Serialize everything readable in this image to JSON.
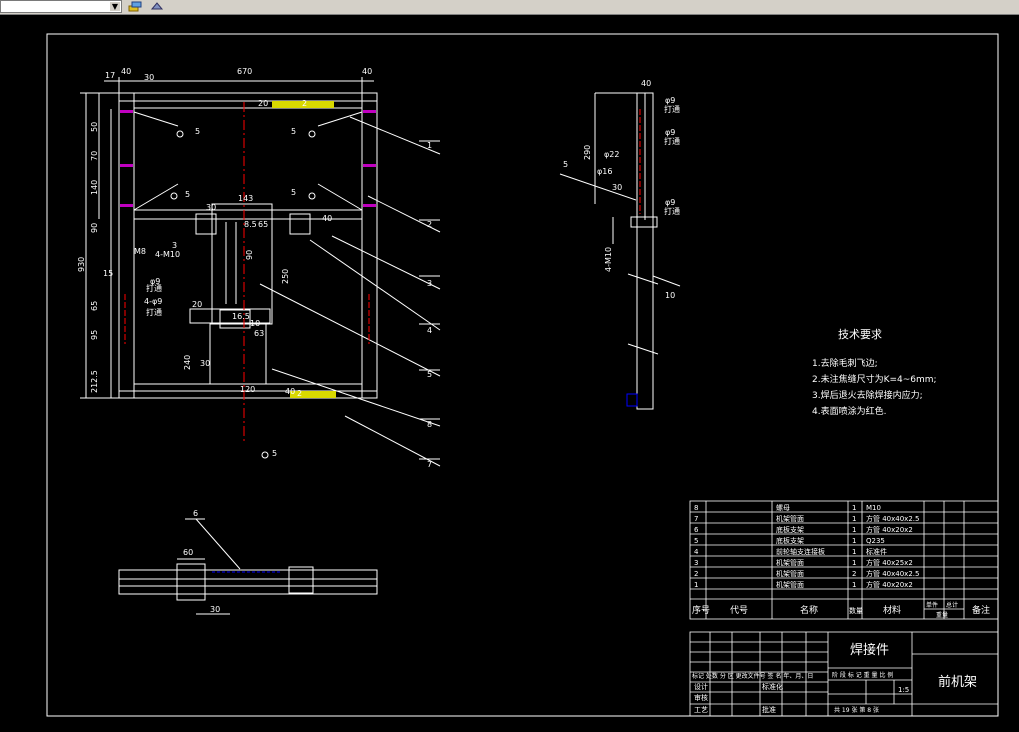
{
  "toolbar": {
    "layer_combo_value": "",
    "icons": [
      "layer-states-icon",
      "layer-previous-icon"
    ]
  },
  "main_view": {
    "dims_top": [
      "17",
      "40",
      "30",
      "670",
      "40",
      "20",
      "2"
    ],
    "dims_left": [
      "50",
      "70",
      "140",
      "90",
      "930",
      "15",
      "65",
      "95",
      "212.5"
    ],
    "dims_inner": [
      "143",
      "30",
      "8.5",
      "65",
      "40",
      "3",
      "M8",
      "4-M10",
      "90",
      "250",
      "16.5",
      "10",
      "63",
      "20",
      "240",
      "30",
      "120",
      "40",
      "2"
    ],
    "hole_notes": [
      "φ9",
      "打通",
      "4-φ9",
      "打通"
    ],
    "weld_marks": [
      "5",
      "5",
      "5",
      "5",
      "5"
    ],
    "callouts": [
      "1",
      "2",
      "3",
      "4",
      "5",
      "8",
      "7"
    ]
  },
  "side_view": {
    "dims": [
      "40",
      "290",
      "φ22",
      "φ16",
      "30",
      "4-M10",
      "10"
    ],
    "hole_notes": [
      "φ9",
      "打通",
      "φ9",
      "打通",
      "φ9",
      "打通"
    ],
    "weld_marks": [
      "5"
    ]
  },
  "bottom_view": {
    "dims": [
      "60",
      "30"
    ],
    "callout": "6"
  },
  "tech_requirements": {
    "title": "技术要求",
    "items": [
      "1.去除毛刺飞边;",
      "2.未注焦缝尺寸为K=4~6mm;",
      "3.焊后退火去除焊接内应力;",
      "4.表面喷涂为红色."
    ]
  },
  "bom": {
    "rows": [
      {
        "no": "8",
        "name": "螺母",
        "qty": "1",
        "material": "M10"
      },
      {
        "no": "7",
        "name": "机架管面",
        "qty": "1",
        "material": "方管 40x40x2.5"
      },
      {
        "no": "6",
        "name": "底板支架",
        "qty": "1",
        "material": "方管 40x20x2"
      },
      {
        "no": "5",
        "name": "底板支架",
        "qty": "1",
        "material": "Q235"
      },
      {
        "no": "4",
        "name": "前轮轴支连接板",
        "qty": "1",
        "material": "标准件"
      },
      {
        "no": "3",
        "name": "机架管面",
        "qty": "1",
        "material": "方管 40x25x2"
      },
      {
        "no": "2",
        "name": "机架管面",
        "qty": "2",
        "material": "方管 40x40x2.5"
      },
      {
        "no": "1",
        "name": "机架管面",
        "qty": "1",
        "material": "方管 40x20x2"
      }
    ],
    "headers": {
      "no": "序号",
      "code": "代号",
      "name": "名称",
      "qty": "数量",
      "material": "材料",
      "unit_weight": "单件",
      "total_weight": "总计",
      "weight": "重量",
      "remarks": "备注"
    }
  },
  "title_block": {
    "part_name": "焊接件",
    "drawing_title": "前机架",
    "scale": "1:5",
    "rev_labels": "标记 处数  分 区  更改文件号 签 名 年、月、日",
    "design": "设计",
    "standardize": "标准化",
    "review": "审核",
    "process": "工艺",
    "approve": "批准",
    "stage_labels": "阶 段 标 记   重 量  比 例",
    "sheet_info": "共 19 张   第 8 张"
  },
  "colors": {
    "background": "#000000",
    "lines": "#ffffff",
    "weld_fill": "#d8d800",
    "center_line": "#ff0000",
    "hidden": "#0000ff",
    "magenta": "#c000c0"
  }
}
